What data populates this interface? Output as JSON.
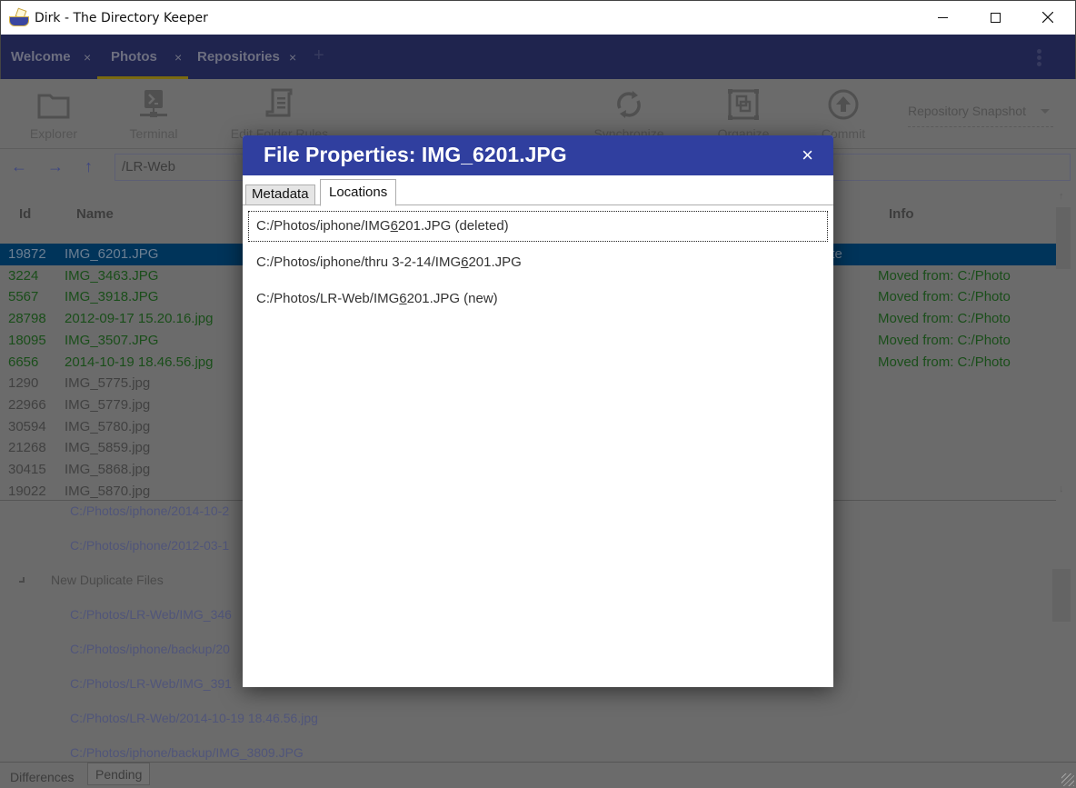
{
  "window": {
    "title": "Dirk - The Directory Keeper",
    "controls": {
      "minimize": "minimize",
      "maximize": "maximize",
      "close": "close"
    }
  },
  "tabs": [
    {
      "label": "Welcome",
      "active": false
    },
    {
      "label": "Photos",
      "active": true
    },
    {
      "label": "Repositories",
      "active": false
    }
  ],
  "tab_close_glyph": "×",
  "tab_add_glyph": "+",
  "toolbar": {
    "explorer": "Explorer",
    "terminal": "Terminal",
    "edit_folder_rules": "Edit Folder Rules",
    "synchronize": "Synchronize",
    "organize": "Organize",
    "commit": "Commit",
    "snapshot_select": "Repository Snapshot"
  },
  "nav": {
    "back": "←",
    "forward": "→",
    "up": "↑",
    "path": "/LR-Web"
  },
  "table": {
    "headers": {
      "id": "Id",
      "name": "Name",
      "info": "Info"
    },
    "rows": [
      {
        "id": "19872",
        "name": "IMG_6201.JPG",
        "info": "ate",
        "state": "selected"
      },
      {
        "id": "3224",
        "name": "IMG_3463.JPG",
        "info": "Moved from: C:/Photo",
        "state": "green"
      },
      {
        "id": "5567",
        "name": "IMG_3918.JPG",
        "info": "Moved from: C:/Photo",
        "state": "green"
      },
      {
        "id": "28798",
        "name": "2012-09-17 15.20.16.jpg",
        "info": "Moved from: C:/Photo",
        "state": "green"
      },
      {
        "id": "18095",
        "name": "IMG_3507.JPG",
        "info": "Moved from: C:/Photo",
        "state": "green"
      },
      {
        "id": "6656",
        "name": "2014-10-19 18.46.56.jpg",
        "info": "Moved from: C:/Photo",
        "state": "green"
      },
      {
        "id": "1290",
        "name": "IMG_5775.jpg",
        "info": "",
        "state": "grey"
      },
      {
        "id": "22966",
        "name": "IMG_5779.jpg",
        "info": "",
        "state": "grey"
      },
      {
        "id": "30594",
        "name": "IMG_5780.jpg",
        "info": "",
        "state": "grey"
      },
      {
        "id": "21268",
        "name": "IMG_5859.jpg",
        "info": "",
        "state": "grey"
      },
      {
        "id": "30415",
        "name": "IMG_5868.jpg",
        "info": "",
        "state": "grey"
      },
      {
        "id": "19022",
        "name": "IMG_5870.jpg",
        "info": "",
        "state": "grey"
      }
    ]
  },
  "tree": {
    "items": [
      {
        "type": "path",
        "text": "C:/Photos/iphone/2014-10-2"
      },
      {
        "type": "path",
        "text": "C:/Photos/iphone/2012-03-1"
      },
      {
        "type": "group",
        "text": "New Duplicate Files"
      },
      {
        "type": "path",
        "text": "C:/Photos/LR-Web/IMG_346"
      },
      {
        "type": "path",
        "text": "C:/Photos/iphone/backup/20"
      },
      {
        "type": "path",
        "text": "C:/Photos/LR-Web/IMG_391"
      },
      {
        "type": "path",
        "text": "C:/Photos/LR-Web/2014-10-19 18.46.56.jpg"
      },
      {
        "type": "path",
        "text": "C:/Photos/iphone/backup/IMG_3809.JPG"
      }
    ]
  },
  "bottom_tabs": {
    "differences": "Differences",
    "pending": "Pending"
  },
  "dialog": {
    "title": "File Properties: IMG_6201.JPG",
    "close_glyph": "×",
    "tabs": {
      "metadata": "Metadata",
      "locations": "Locations"
    },
    "active_tab": "Locations",
    "locations": [
      {
        "prefix": "C:/Photos/iphone/IMG",
        "mnemonic": "6",
        "suffix": "201.JPG (deleted)",
        "focused": true
      },
      {
        "prefix": "C:/Photos/iphone/thru 3-2-14/IMG",
        "mnemonic": "6",
        "suffix": "201.JPG",
        "focused": false
      },
      {
        "prefix": "C:/Photos/LR-Web/IMG",
        "mnemonic": "6",
        "suffix": "201.JPG (new)",
        "focused": false
      }
    ]
  },
  "colors": {
    "dialog_header": "#303f9f",
    "tabbar_dimmed": "#1f244e",
    "selected_row_dimmed": "#00345a",
    "overlay_gray": "#6b6b6b",
    "moved_text_dimmed": "#1a4e1a"
  }
}
